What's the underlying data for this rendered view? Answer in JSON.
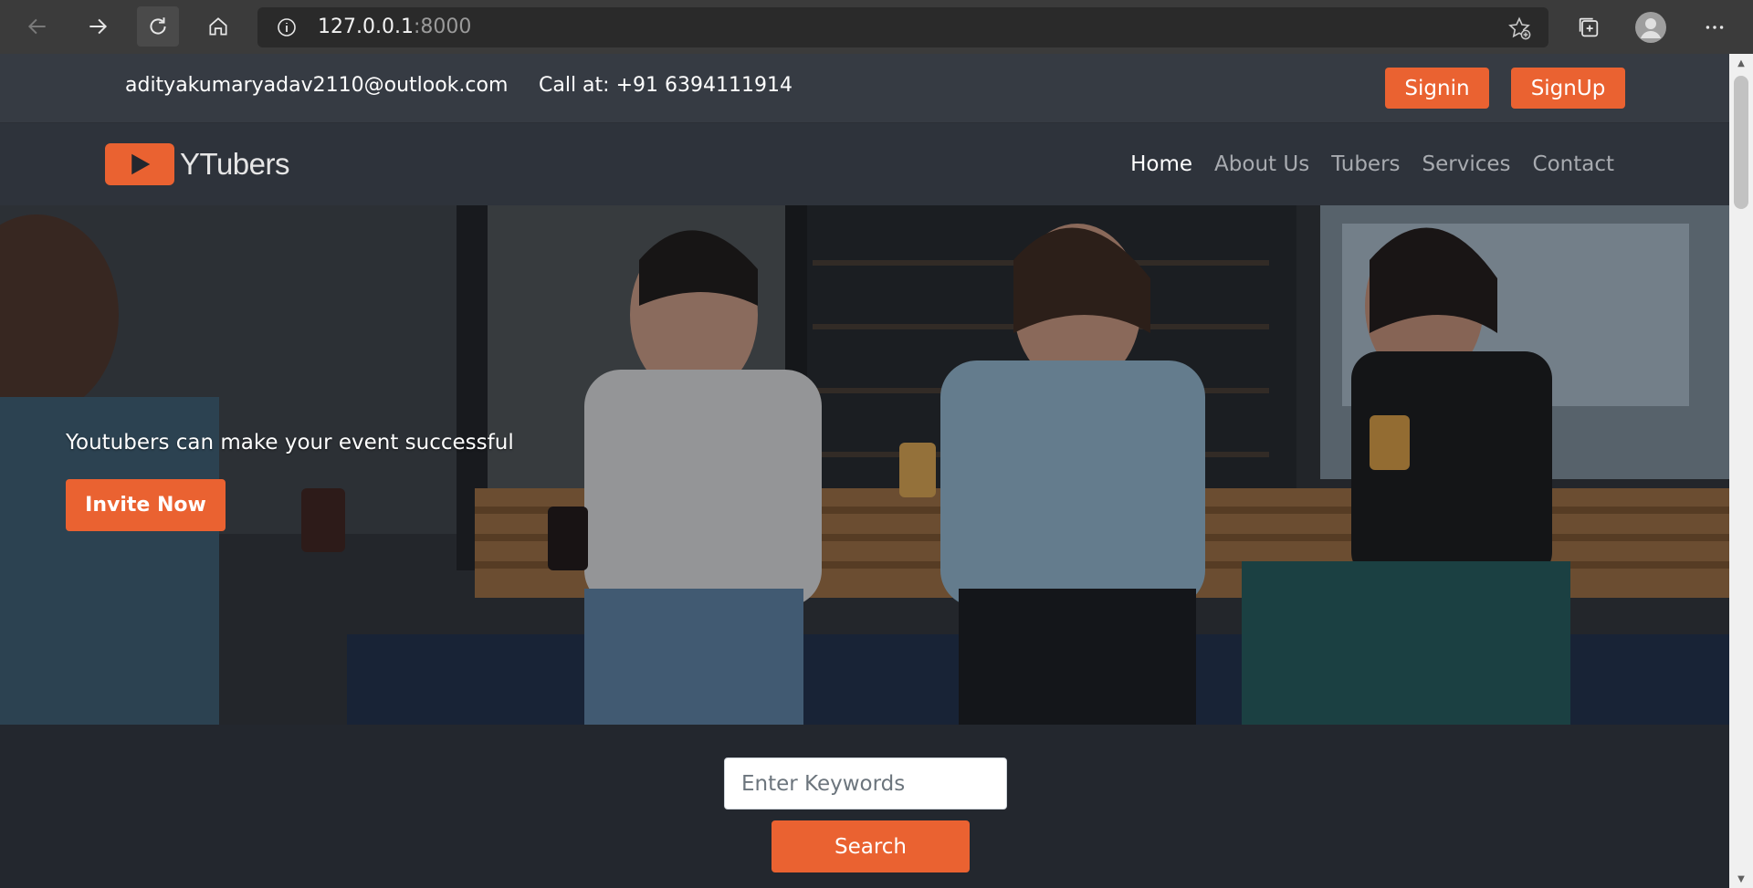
{
  "browser": {
    "url_host": "127.0.0.1",
    "url_port": ":8000"
  },
  "topbar": {
    "email": "adityakumaryadav2110@outlook.com",
    "phone": "Call at: +91 6394111914",
    "signin_label": "Signin",
    "signup_label": "SignUp"
  },
  "nav": {
    "brand": "YTubers",
    "links": [
      {
        "label": "Home",
        "active": true
      },
      {
        "label": "About Us",
        "active": false
      },
      {
        "label": "Tubers",
        "active": false
      },
      {
        "label": "Services",
        "active": false
      },
      {
        "label": "Contact",
        "active": false
      }
    ]
  },
  "hero": {
    "tagline": "Youtubers can make your event successful",
    "cta_label": "Invite Now"
  },
  "search": {
    "placeholder": "Enter Keywords",
    "button_label": "Search"
  },
  "colors": {
    "accent": "#ea6231",
    "page_bg": "#23272e",
    "topbar_bg": "#363b43",
    "nav_bg": "#2e333b"
  }
}
